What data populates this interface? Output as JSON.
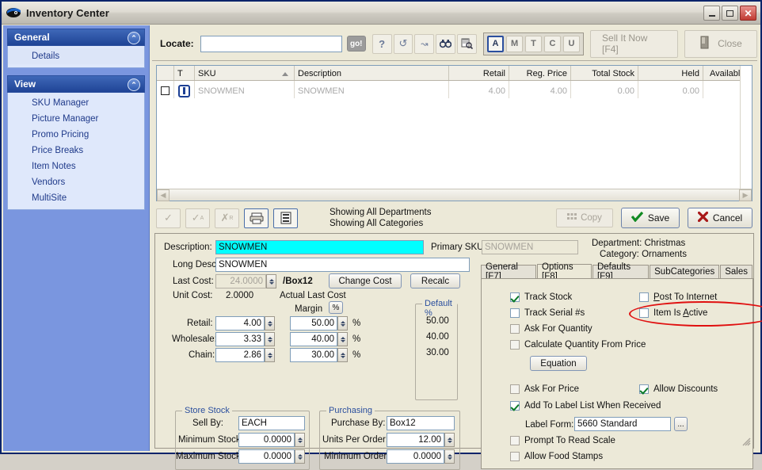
{
  "window": {
    "title": "Inventory Center",
    "minimize": "_",
    "maximize": "□",
    "close": "✕"
  },
  "sidebar": {
    "groups": [
      {
        "header": "General",
        "items": [
          {
            "label": "Details",
            "selected": true
          }
        ]
      },
      {
        "header": "View",
        "items": [
          {
            "label": "SKU Manager"
          },
          {
            "label": "Picture Manager"
          },
          {
            "label": "Promo Pricing"
          },
          {
            "label": "Price Breaks"
          },
          {
            "label": "Item Notes"
          },
          {
            "label": "Vendors"
          },
          {
            "label": "MultiSite"
          }
        ]
      }
    ]
  },
  "toolbar": {
    "locate_label": "Locate:",
    "locate_value": "",
    "go_label": "go!",
    "tools": [
      "?",
      "↺",
      "↝",
      "🔍",
      "📄"
    ],
    "mode_buttons": [
      {
        "label": "A",
        "active": true
      },
      {
        "label": "M",
        "active": false
      },
      {
        "label": "T",
        "active": false
      },
      {
        "label": "C",
        "active": false
      },
      {
        "label": "U",
        "active": false
      }
    ],
    "sell_it_now": "Sell It Now [F4]",
    "close": "Close"
  },
  "grid": {
    "columns": [
      "",
      "T",
      "SKU",
      "Description",
      "Retail",
      "Reg. Price",
      "Total Stock",
      "Held",
      "Availabl"
    ],
    "sorted_column": "SKU",
    "rows": [
      {
        "checked": false,
        "sku": "SNOWMEN",
        "description": "SNOWMEN",
        "retail": "4.00",
        "reg_price": "4.00",
        "total_stock": "0.00",
        "held": "0.00",
        "available": ""
      }
    ]
  },
  "midbar": {
    "status_line1": "Showing All Departments",
    "status_line2": "Showing All Categories",
    "copy_label": "Copy",
    "save_label": "Save",
    "cancel_label": "Cancel"
  },
  "form": {
    "description_label": "Description:",
    "description_value": "SNOWMEN",
    "primary_sku_label": "Primary SKU:",
    "primary_sku_value": "SNOWMEN",
    "long_desc_label": "Long Desc:",
    "long_desc_value": "SNOWMEN",
    "last_cost_label": "Last Cost:",
    "last_cost_value": "24.0000",
    "last_cost_unit": "/Box12",
    "change_cost_label": "Change Cost",
    "recalc_label": "Recalc",
    "unit_cost_label": "Unit Cost:",
    "unit_cost_value": "2.0000",
    "actual_last_cost_label": "Actual Last Cost",
    "margin_label": "Margin",
    "margin_button": "%",
    "default_pct_title": "Default %",
    "department_label": "Department:",
    "department_value": "Christmas",
    "category_label": "Category:",
    "category_value": "Ornaments",
    "price_rows": [
      {
        "label": "Retail:",
        "price": "4.00",
        "margin": "50.00",
        "pct": "%",
        "default": "50.00"
      },
      {
        "label": "Wholesale:",
        "price": "3.33",
        "margin": "40.00",
        "pct": "%",
        "default": "40.00"
      },
      {
        "label": "Chain:",
        "price": "2.86",
        "margin": "30.00",
        "pct": "%",
        "default": "30.00"
      }
    ],
    "store_stock": {
      "title": "Store Stock",
      "sell_by_label": "Sell By:",
      "sell_by_value": "EACH",
      "min_label": "Minimum Stock:",
      "min_value": "0.0000",
      "max_label": "Maximum Stock:",
      "max_value": "0.0000"
    },
    "purchasing": {
      "title": "Purchasing",
      "purchase_by_label": "Purchase By:",
      "purchase_by_value": "Box12",
      "units_label": "Units Per Order:",
      "units_value": "12.00",
      "min_order_label": "Minimum Order:",
      "min_order_value": "0.0000"
    }
  },
  "tabs": [
    {
      "label": "General [F7]",
      "active": false
    },
    {
      "label": "Options [F8]",
      "active": true
    },
    {
      "label": "Defaults [F9]",
      "active": false
    },
    {
      "label": "SubCategories",
      "active": false
    },
    {
      "label": "Sales",
      "active": false
    }
  ],
  "options": {
    "track_stock": {
      "label": "Track Stock",
      "checked": true
    },
    "track_serial": {
      "label": "Track Serial #s",
      "checked": false
    },
    "ask_quantity": {
      "label": "Ask For Quantity",
      "checked": false,
      "shaded": true
    },
    "calc_quantity": {
      "label": "Calculate Quantity From Price",
      "checked": false,
      "shaded": true
    },
    "post_internet": {
      "label": "Post To Internet",
      "checked": false
    },
    "item_active": {
      "label": "Item Is Active",
      "checked": false,
      "highlighted": true
    },
    "equation_button": "Equation",
    "ask_price": {
      "label": "Ask For Price",
      "checked": false,
      "shaded": true
    },
    "allow_discounts": {
      "label": "Allow Discounts",
      "checked": true
    },
    "add_label_list": {
      "label": "Add To Label List When Received",
      "checked": true
    },
    "label_form_label": "Label Form:",
    "label_form_value": "5660 Standard",
    "label_form_browse": "...",
    "prompt_scale": {
      "label": "Prompt To Read Scale",
      "checked": false,
      "shaded": true
    },
    "food_stamps": {
      "label": "Allow Food Stamps",
      "checked": false,
      "shaded": true
    }
  },
  "colors": {
    "accent": "#1f4496",
    "highlight": "#00ffff",
    "annotation": "#e01010",
    "nav_bg": "#7a96df"
  }
}
